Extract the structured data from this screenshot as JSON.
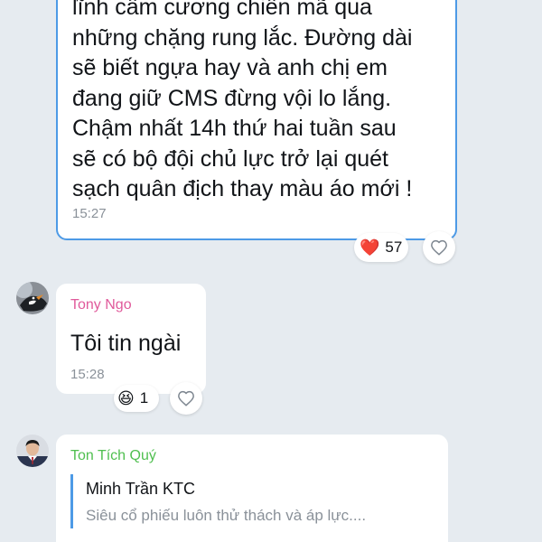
{
  "colors": {
    "background": "#e6ebf0",
    "bubble": "#ffffff",
    "highlight_border": "#4d9ae6",
    "sender_tony": "#e05a9b",
    "sender_ton": "#4fbf4f",
    "time": "#8a9199"
  },
  "messages": [
    {
      "text": "lĩnh cầm cương chiến mã qua\nnhững chặng rung lắc. Đường dài\nsẽ biết ngựa hay và anh chị em\nđang giữ CMS đừng vội lo lắng.\nChậm nhất 14h thứ hai tuần sau\nsẽ có bộ đội chủ lực trở lại quét\nsạch quân địch thay màu áo mới !",
      "time": "15:27",
      "reaction": {
        "icon": "red-heart-icon",
        "emoji": "❤️",
        "count": "57"
      },
      "like_icon": "heart-outline-icon"
    },
    {
      "sender": "Tony Ngo",
      "avatar_icon": "bird-avatar",
      "text": "Tôi tin ngài",
      "time": "15:28",
      "reaction": {
        "icon": "laughing-face-icon",
        "emoji": "😆",
        "count": "1"
      },
      "like_icon": "heart-outline-icon"
    },
    {
      "sender": "Ton Tích Quý",
      "avatar_icon": "person-avatar",
      "quote": {
        "author": "Minh Trần KTC",
        "text": "Siêu cổ phiếu luôn thử thách và áp lực...."
      }
    }
  ]
}
